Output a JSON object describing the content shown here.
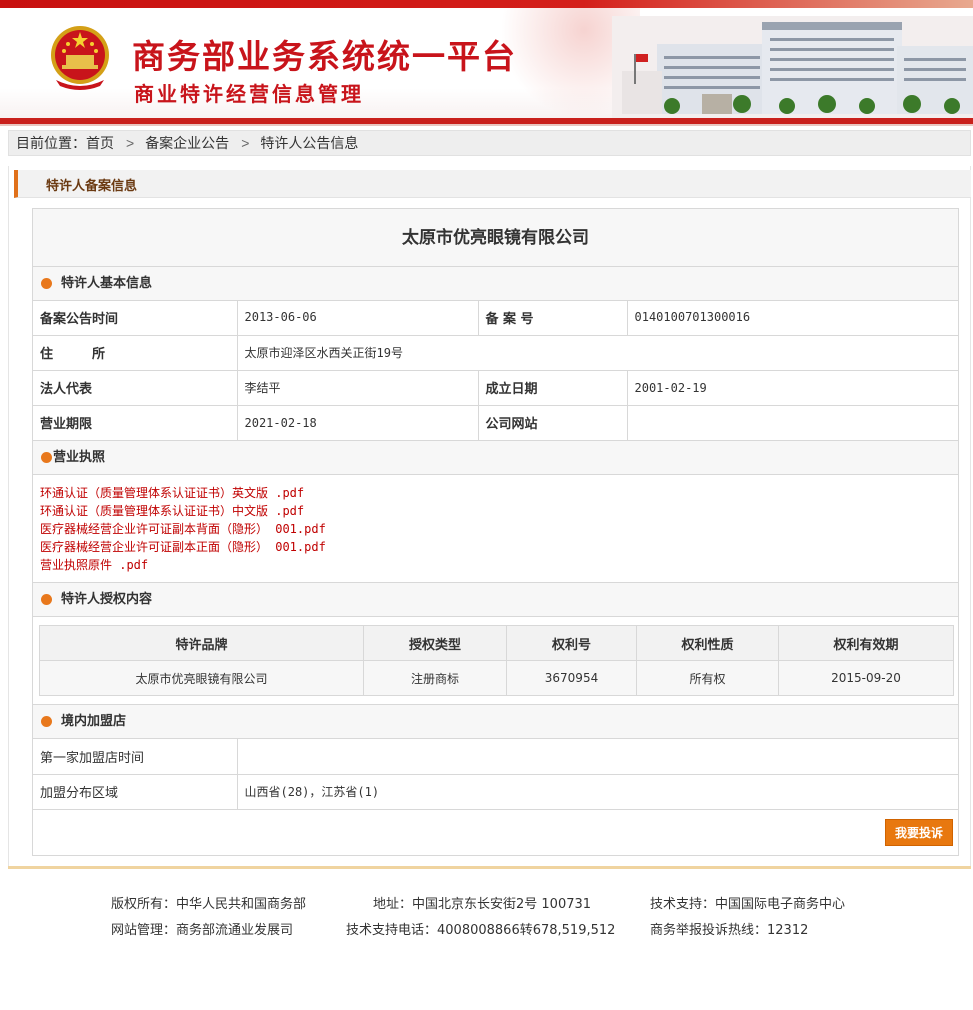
{
  "header": {
    "title": "商务部业务系统统一平台",
    "subtitle": "商业特许经营信息管理",
    "emblem_icon": "national-emblem-icon",
    "building_image": "ministry-building-image",
    "accent_color": "#c8141b"
  },
  "breadcrumb": {
    "prefix": "目前位置：",
    "items": [
      "首页",
      "备案企业公告",
      "特许人公告信息"
    ],
    "separator": ">"
  },
  "section": {
    "title": "特许人备案信息"
  },
  "company": {
    "name": "太原市优亮眼镜有限公司"
  },
  "basic_info": {
    "heading": "特许人基本信息",
    "rows": [
      {
        "k1": "备案公告时间",
        "v1": "2013-06-06",
        "k2": "备 案 号",
        "v2": "0140100701300016"
      },
      {
        "k1": "住　　　所",
        "v1": "太原市迎泽区水西关正街19号"
      },
      {
        "k1": "法人代表",
        "v1": "李结平",
        "k2": "成立日期",
        "v2": "2001-02-19"
      },
      {
        "k1": "营业期限",
        "v1": "2021-02-18",
        "k2": "公司网站",
        "v2": ""
      }
    ]
  },
  "license": {
    "heading": "营业执照",
    "files": [
      "环通认证（质量管理体系认证证书）英文版 .pdf",
      "环通认证（质量管理体系认证证书）中文版 .pdf",
      "医疗器械经营企业许可证副本背面（隐形） 001.pdf",
      "医疗器械经营企业许可证副本正面（隐形） 001.pdf",
      "营业执照原件 .pdf"
    ]
  },
  "authorization": {
    "heading": "特许人授权内容",
    "columns": [
      "特许品牌",
      "授权类型",
      "权利号",
      "权利性质",
      "权利有效期"
    ],
    "rows": [
      [
        "太原市优亮眼镜有限公司",
        "注册商标",
        "3670954",
        "所有权",
        "2015-09-20"
      ]
    ]
  },
  "franchise": {
    "heading": "境内加盟店",
    "rows": [
      {
        "k": "第一家加盟店时间",
        "v": ""
      },
      {
        "k": "加盟分布区域",
        "v": "山西省(28)，江苏省(1)"
      }
    ]
  },
  "actions": {
    "complain_label": "我要投诉",
    "complain_color": "#e8780f"
  },
  "footer": {
    "row1": [
      "版权所有：中华人民共和国商务部",
      "地址：中国北京东长安街2号 100731",
      "技术支持：中国国际电子商务中心"
    ],
    "row2": [
      "网站管理：商务部流通业发展司",
      "技术支持电话：4008008866转678,519,512",
      "商务举报投诉热线：12312"
    ]
  }
}
